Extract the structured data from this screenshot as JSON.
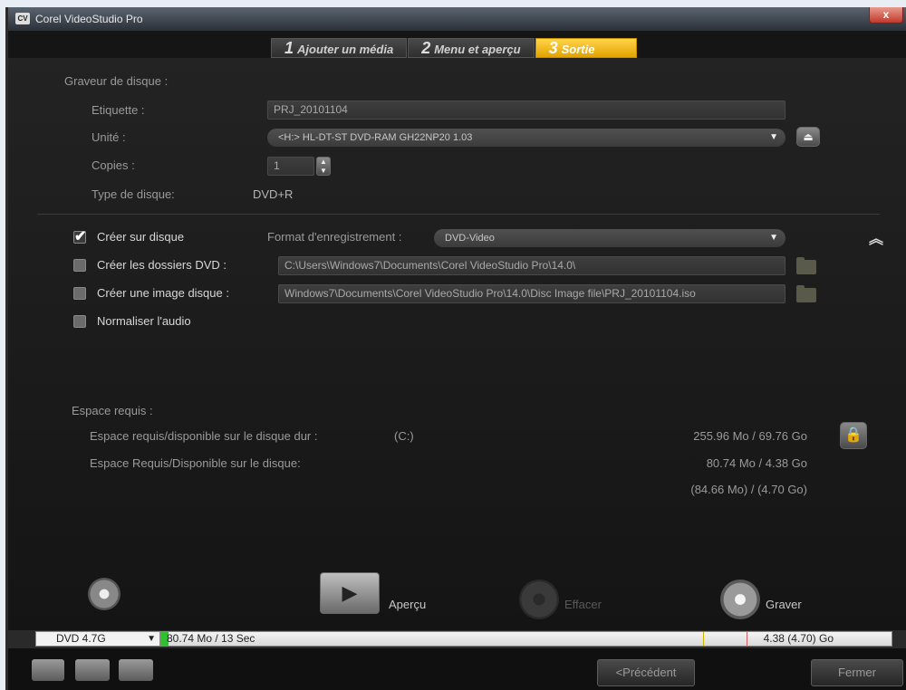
{
  "window": {
    "title": "Corel VideoStudio Pro",
    "close_label": "x"
  },
  "tabs": [
    {
      "num": "1",
      "label": "Ajouter un média",
      "active": false
    },
    {
      "num": "2",
      "label": "Menu et aperçu",
      "active": false
    },
    {
      "num": "3",
      "label": "Sortie",
      "active": true
    }
  ],
  "burner": {
    "section_label": "Graveur de disque :",
    "label_field_label": "Etiquette :",
    "label_value": "PRJ_20101104",
    "unit_label": "Unité :",
    "unit_value": "<H:>  HL-DT-ST DVD-RAM GH22NP20 1.03",
    "copies_label": "Copies :",
    "copies_value": "1",
    "disc_type_label": "Type de disque:",
    "disc_type_value": "DVD+R"
  },
  "options": {
    "create_on_disc": {
      "label": "Créer sur disque",
      "checked": true
    },
    "format_label": "Format d'enregistrement :",
    "format_value": "DVD-Video",
    "create_dvd_folders": {
      "label": "Créer les dossiers DVD :",
      "checked": false,
      "path": "C:\\Users\\Windows7\\Documents\\Corel VideoStudio Pro\\14.0\\"
    },
    "create_disc_image": {
      "label": "Créer une image disque :",
      "checked": false,
      "path": "Windows7\\Documents\\Corel VideoStudio Pro\\14.0\\Disc Image file\\PRJ_20101104.iso"
    },
    "normalize_audio": {
      "label": "Normaliser l'audio",
      "checked": false
    }
  },
  "space": {
    "section_label": "Espace requis :",
    "hdd_label": "Espace requis/disponible sur le disque dur :",
    "hdd_drive": "(C:)",
    "hdd_value": "255.96 Mo  /  69.76 Go",
    "disc_label": "Espace Requis/Disponible sur le disque:",
    "disc_value": "80.74 Mo  /  4.38 Go",
    "disc_value2": "(84.66 Mo)  /  (4.70 Go)"
  },
  "actions": {
    "preview_label": "Aperçu",
    "erase_label": "Effacer",
    "burn_label": "Graver"
  },
  "status": {
    "disc_size": "DVD 4.7G",
    "used": "80.74 Mo / 13 Sec",
    "capacity": "4.38 (4.70) Go",
    "fill_fraction": 0.01
  },
  "nav": {
    "previous_label": "<Précédent",
    "close_label": "Fermer"
  },
  "colors": {
    "active_tab": "#e3a200",
    "progress_fill": "#2fbf2f"
  }
}
